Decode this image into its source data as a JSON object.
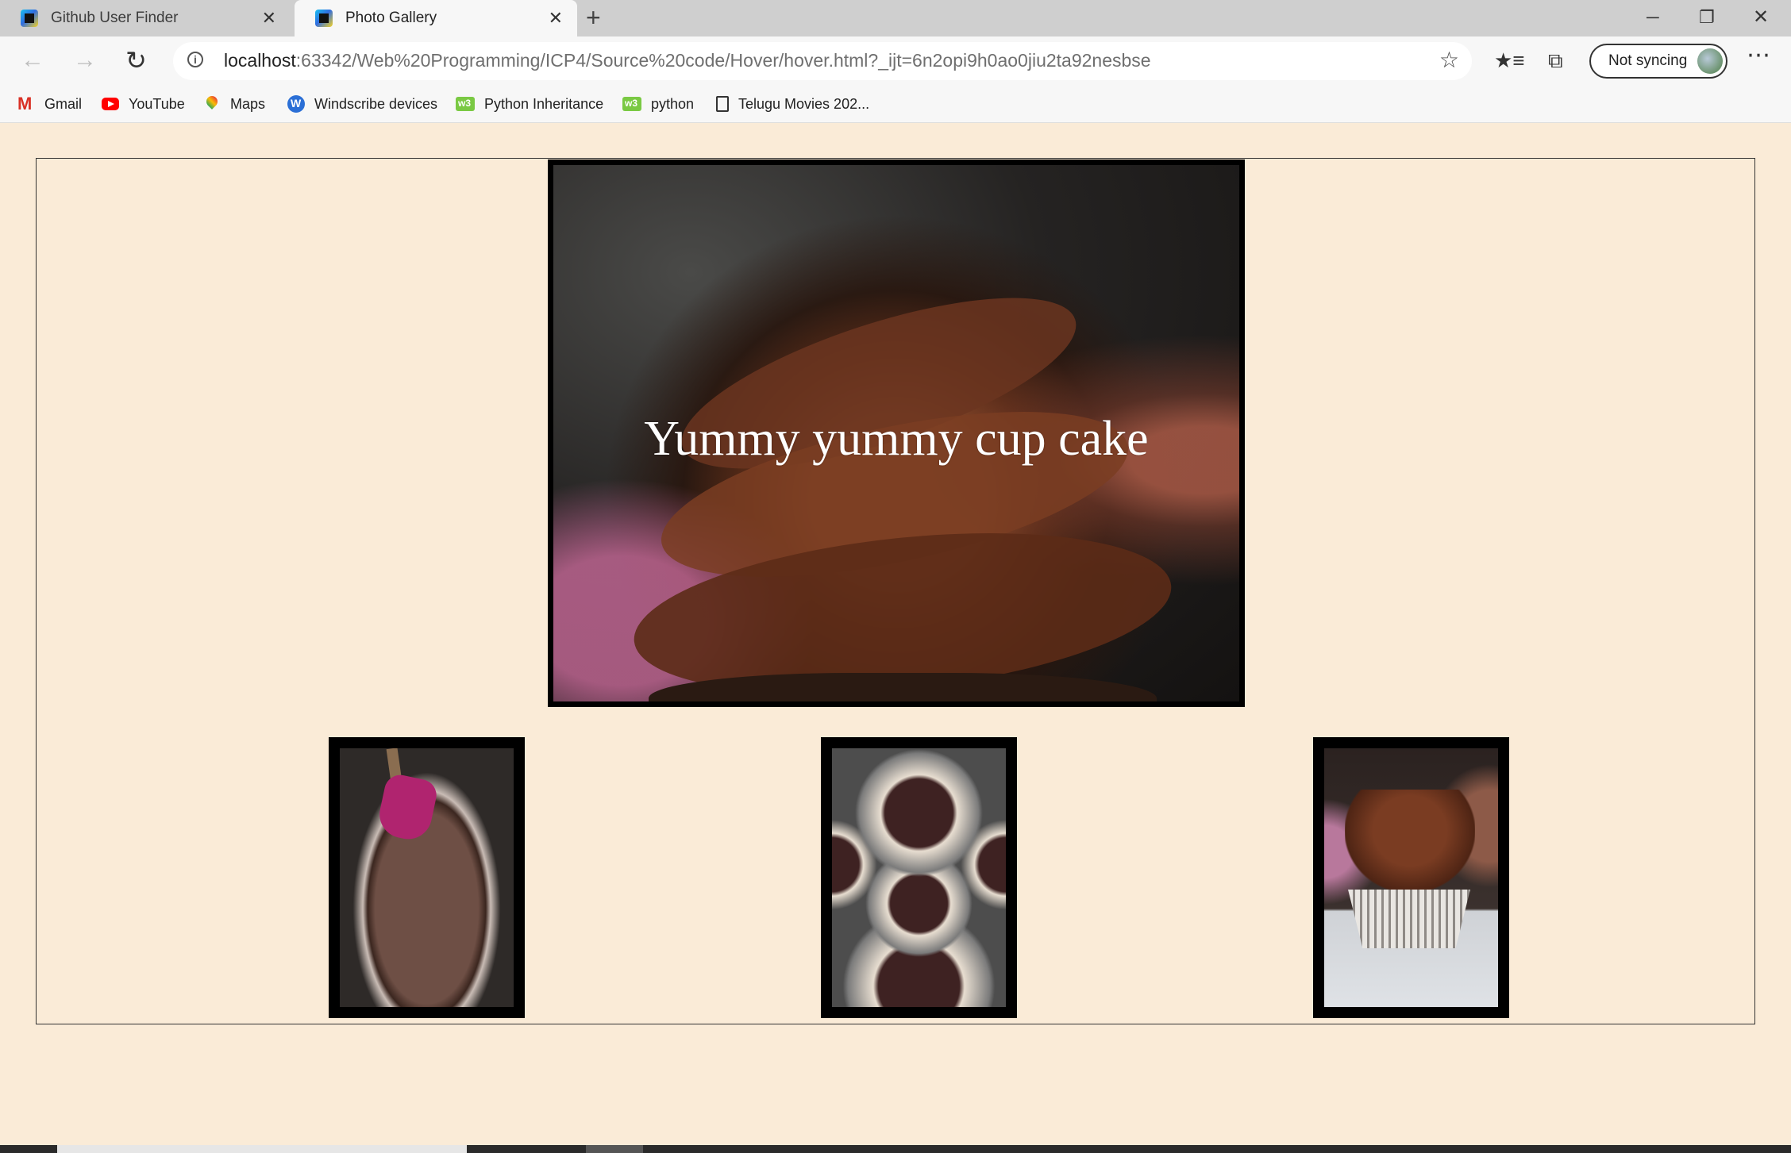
{
  "browser": {
    "tabs": [
      {
        "title": "Github User Finder",
        "active": false
      },
      {
        "title": "Photo Gallery",
        "active": true
      }
    ],
    "new_tab_label": "+",
    "window_controls": {
      "minimize": "─",
      "maximize": "❐",
      "close": "✕"
    },
    "address": {
      "host": "localhost",
      "rest": ":63342/Web%20Programming/ICP4/Source%20code/Hover/hover.html?_ijt=6n2opi9h0ao0jiu2ta92nesbse"
    },
    "profile_button_label": "Not syncing",
    "icons": {
      "back": "back-arrow-icon",
      "forward": "forward-arrow-icon",
      "reload": "reload-icon",
      "info": "site-info-icon",
      "star": "star-icon",
      "favorites": "favorites-icon",
      "collections": "collections-icon",
      "more": "more-icon"
    },
    "bookmarks": [
      {
        "label": "Gmail",
        "icon": "gmail-icon"
      },
      {
        "label": "YouTube",
        "icon": "youtube-icon"
      },
      {
        "label": "Maps",
        "icon": "maps-icon"
      },
      {
        "label": "Windscribe devices",
        "icon": "windscribe-icon"
      },
      {
        "label": "Python Inheritance",
        "icon": "w3schools-icon"
      },
      {
        "label": "python",
        "icon": "w3schools-icon"
      },
      {
        "label": "Telugu Movies 202...",
        "icon": "page-icon"
      }
    ]
  },
  "page": {
    "background_color": "#faebd7",
    "main_image": {
      "caption": "Yummy yummy cup cake",
      "subject": "chocolate frosted cupcake close-up"
    },
    "thumbnails": [
      {
        "subject": "chocolate batter in bowl with pink spatula"
      },
      {
        "subject": "cupcake liners filled with batter in tin"
      },
      {
        "subject": "chocolate cupcake with frosting"
      }
    ]
  }
}
